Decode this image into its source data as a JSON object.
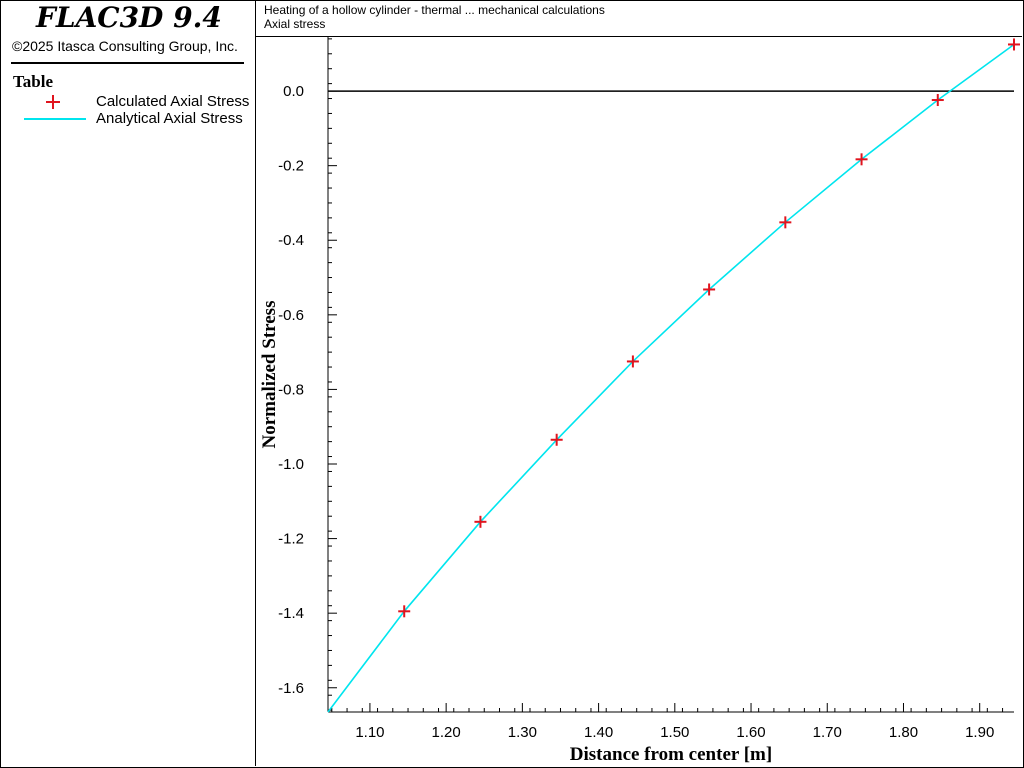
{
  "app": {
    "title": "FLAC3D 9.4",
    "copyright": "©2025 Itasca Consulting Group, Inc."
  },
  "legend": {
    "title": "Table",
    "items": [
      {
        "label": "Calculated Axial Stress",
        "symbol": "plus-marker",
        "color": "#e0141e"
      },
      {
        "label": "Analytical Axial Stress",
        "symbol": "line",
        "color": "#00e5ee"
      }
    ]
  },
  "plot": {
    "title": "Heating of a hollow cylinder - thermal ... mechanical calculations",
    "subtitle": "Axial stress"
  },
  "chart_data": {
    "type": "line",
    "title": "Heating of a hollow cylinder - thermal ... mechanical calculations",
    "subtitle": "Axial stress",
    "xlabel": "Distance from center [m]",
    "ylabel": "Normalized Stress",
    "xlim": [
      1.045,
      1.945
    ],
    "ylim": [
      -1.665,
      0.145
    ],
    "xticks": [
      "1.10",
      "1.20",
      "1.30",
      "1.40",
      "1.50",
      "1.60",
      "1.70",
      "1.80",
      "1.90"
    ],
    "yticks": [
      "0.0",
      "-0.2",
      "-0.4",
      "-0.6",
      "-0.8",
      "-1.0",
      "-1.2",
      "-1.4",
      "-1.6"
    ],
    "zero_line": true,
    "grid": false,
    "legend_position": "left-panel",
    "series": [
      {
        "name": "Calculated Axial Stress",
        "style": "markers",
        "color": "#e0141e",
        "x": [
          1.145,
          1.245,
          1.345,
          1.445,
          1.545,
          1.645,
          1.745,
          1.845,
          1.945
        ],
        "y": [
          -1.395,
          -1.155,
          -0.935,
          -0.725,
          -0.532,
          -0.352,
          -0.183,
          -0.024,
          0.125
        ]
      },
      {
        "name": "Analytical Axial Stress",
        "style": "line",
        "color": "#00e5ee",
        "x": [
          1.045,
          1.145,
          1.245,
          1.345,
          1.445,
          1.545,
          1.645,
          1.745,
          1.845,
          1.945
        ],
        "y": [
          -1.665,
          -1.395,
          -1.155,
          -0.935,
          -0.725,
          -0.532,
          -0.352,
          -0.183,
          -0.024,
          0.125
        ]
      }
    ]
  }
}
